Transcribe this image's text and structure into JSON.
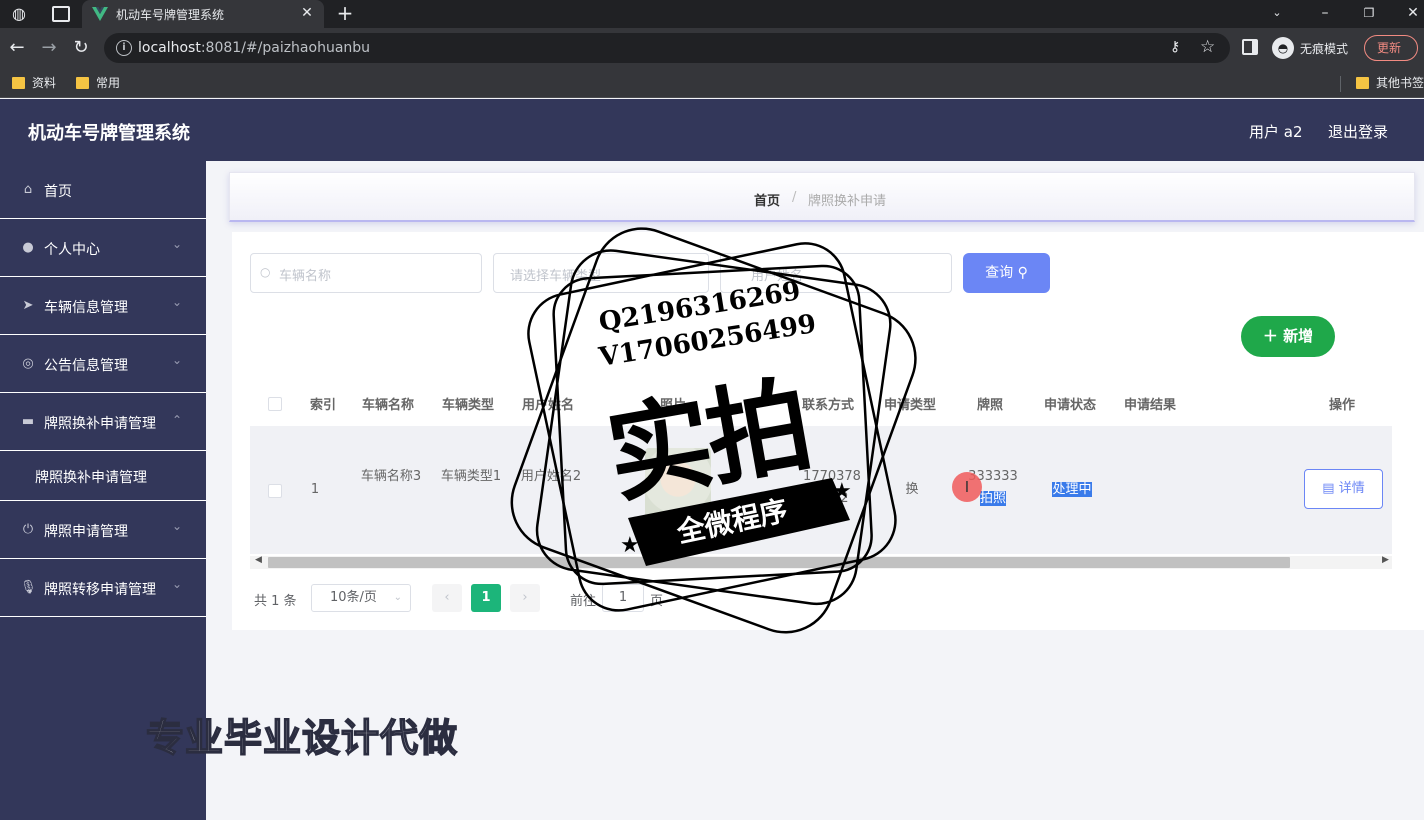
{
  "browser": {
    "tab_title": "机动车号牌管理系统",
    "url_host": "localhost",
    "url_rest": ":8081/#/paizhaohuanbu",
    "incognito_label": "无痕模式",
    "update_label": "更新",
    "bookmarks": [
      "资料",
      "常用"
    ],
    "other_bookmarks": "其他书签"
  },
  "header": {
    "title": "机动车号牌管理系统",
    "user": "用户 a2",
    "logout": "退出登录"
  },
  "sidebar": {
    "items": [
      {
        "label": "首页",
        "icon": "home-icon"
      },
      {
        "label": "个人中心",
        "icon": "user-icon"
      },
      {
        "label": "车辆信息管理",
        "icon": "send-icon"
      },
      {
        "label": "公告信息管理",
        "icon": "circle-icon"
      },
      {
        "label": "牌照换补申请管理",
        "icon": "monitor-icon"
      },
      {
        "label": "牌照申请管理",
        "icon": "power-icon"
      },
      {
        "label": "牌照转移申请管理",
        "icon": "microphone-icon"
      }
    ],
    "submenu": {
      "label": "牌照换补申请管理"
    }
  },
  "breadcrumb": {
    "home": "首页",
    "separator": "/",
    "current": "牌照换补申请"
  },
  "search": {
    "vehicle_name_placeholder": "车辆名称",
    "vehicle_type_placeholder": "请选择车辆类型",
    "user_name_placeholder": "用户姓名",
    "query_label": "查询",
    "add_label": "新增"
  },
  "table": {
    "headers": [
      "索引",
      "车辆名称",
      "车辆类型",
      "用户姓名",
      "照片",
      "联系方式",
      "申请类型",
      "牌照",
      "申请状态",
      "申请结果",
      "操作"
    ],
    "rows": [
      {
        "index": "1",
        "vehicle_name": "车辆名称3",
        "vehicle_type": "车辆类型1",
        "user_name": "用户姓名2",
        "contact": "17703786902",
        "apply_type": "换",
        "plate_line1": "333333",
        "plate_line2": "拍照",
        "status": "处理中",
        "result": "",
        "action": "详情"
      }
    ]
  },
  "pagination": {
    "total": "共 1 条",
    "page_size": "10条/页",
    "current_page": "1",
    "goto_label": "前往",
    "goto_value": "1",
    "page_unit": "页"
  },
  "watermark": {
    "line1": "Q2196316269",
    "line2": "V17060256499",
    "big": "实拍",
    "banner": "全微程序",
    "bottom": "专业毕业设计代做"
  },
  "colors": {
    "sidebar_bg": "#33375a",
    "primary": "#6b86f5",
    "add_button": "#1fa84a",
    "pager_active": "#1cb57a",
    "highlight": "#3a7bea"
  }
}
